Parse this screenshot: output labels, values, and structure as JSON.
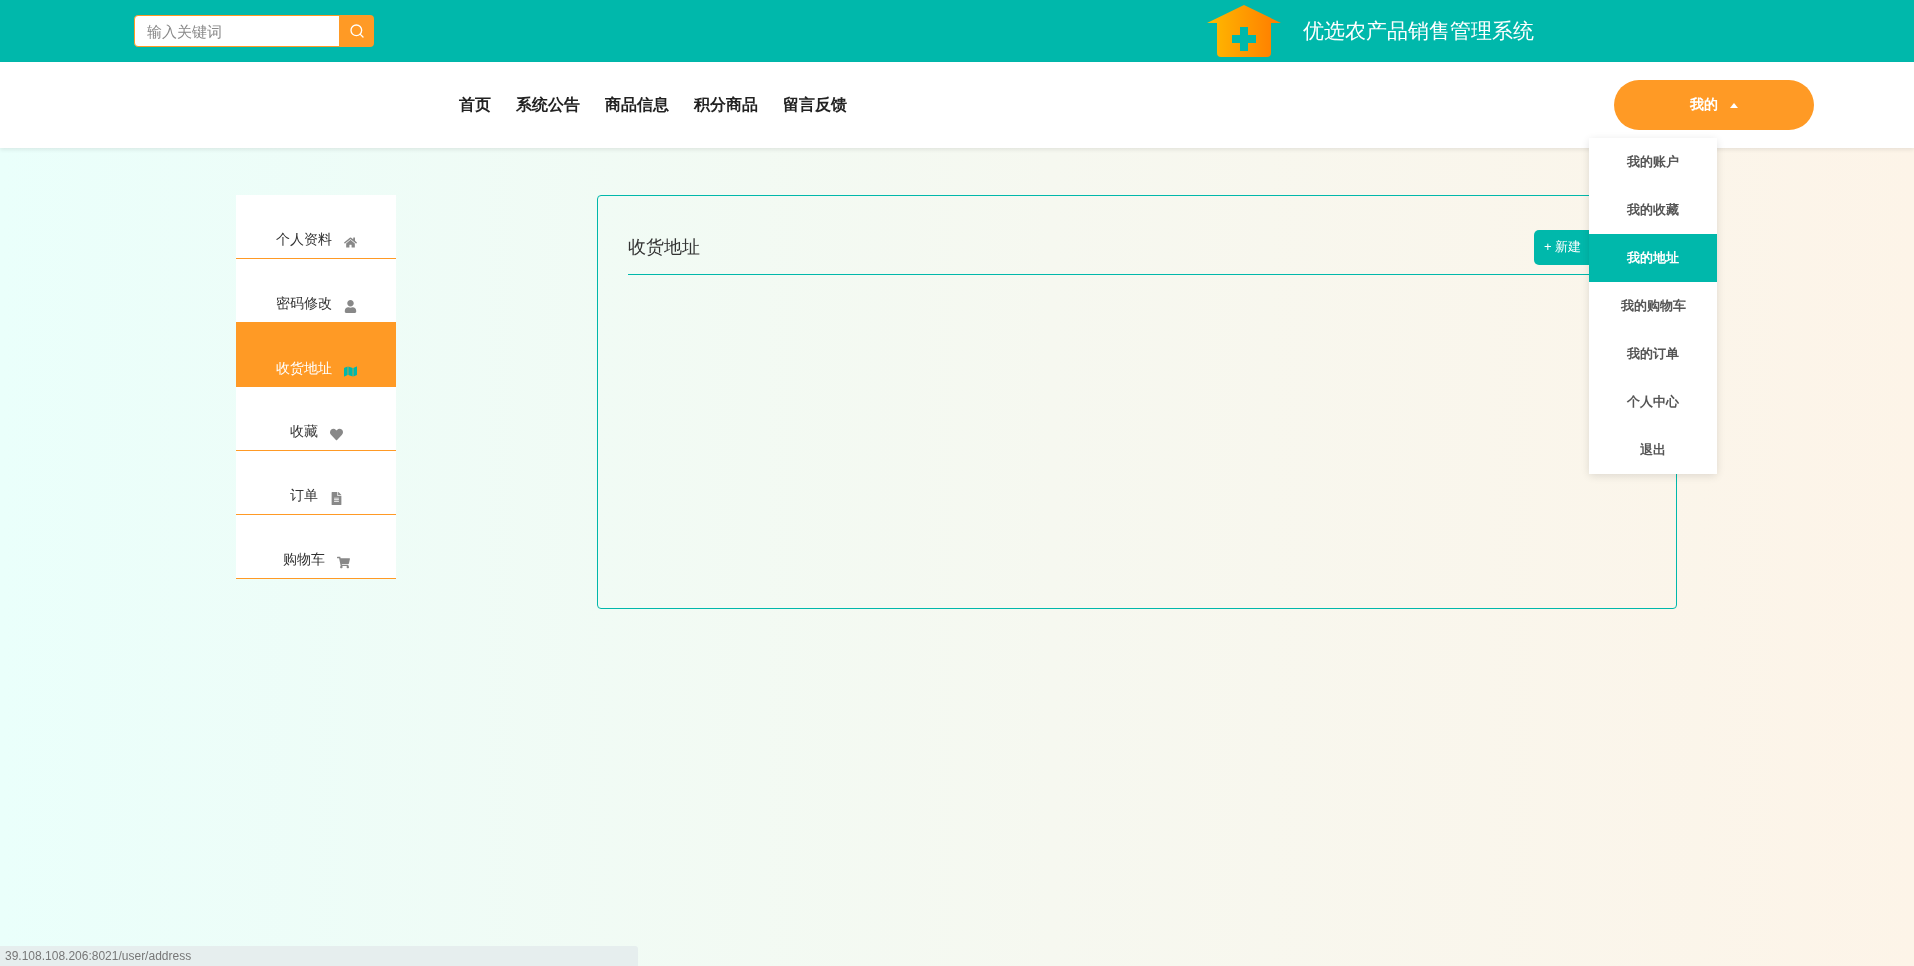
{
  "header": {
    "search": {
      "placeholder": "输入关键词"
    },
    "title": "优选农产品销售管理系统"
  },
  "nav": {
    "items": [
      {
        "label": "首页"
      },
      {
        "label": "系统公告"
      },
      {
        "label": "商品信息"
      },
      {
        "label": "积分商品"
      },
      {
        "label": "留言反馈"
      }
    ],
    "user_button": "我的",
    "expanded": true
  },
  "user_menu": [
    {
      "label": "我的账户",
      "selected": false
    },
    {
      "label": "我的收藏",
      "selected": false
    },
    {
      "label": "我的地址",
      "selected": true
    },
    {
      "label": "我的购物车",
      "selected": false
    },
    {
      "label": "我的订单",
      "selected": false
    },
    {
      "label": "个人中心",
      "selected": false
    },
    {
      "label": "退出",
      "selected": false
    }
  ],
  "sidebar": {
    "items": [
      {
        "label": "个人资料",
        "selected": false
      },
      {
        "label": "密码修改",
        "selected": false
      },
      {
        "label": "收货地址",
        "selected": true
      },
      {
        "label": "收藏",
        "selected": false
      },
      {
        "label": "订单",
        "selected": false
      },
      {
        "label": "购物车",
        "selected": false
      }
    ]
  },
  "panel": {
    "title": "收货地址",
    "new_button": "+ 新建"
  },
  "status_bar": "39.108.108.206:8021/user/address"
}
